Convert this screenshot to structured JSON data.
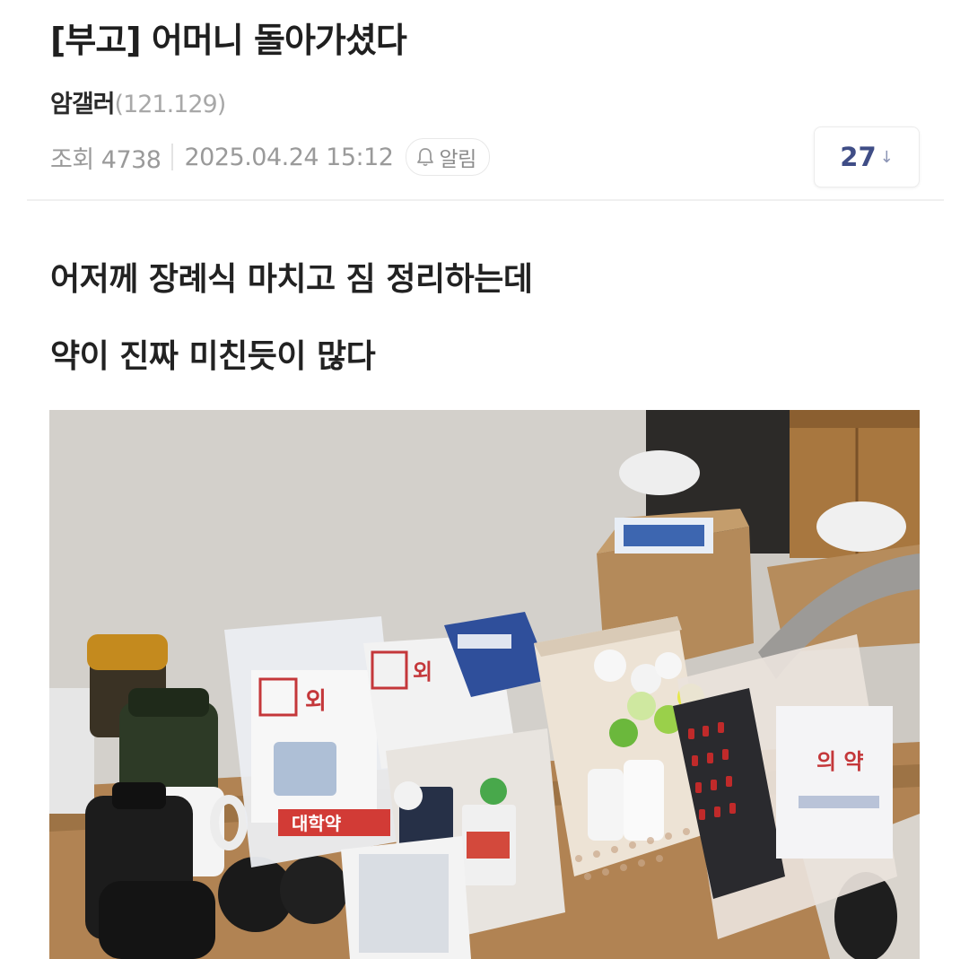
{
  "post": {
    "title": "[부고] 어머니 돌아가셨다",
    "author": "암갤러",
    "author_ip": "(121.129)",
    "views_label": "조회 4738",
    "datetime": "2025.04.24 15:12",
    "alarm_label": "알림",
    "comment_count": "27",
    "comment_arrow": "↓"
  },
  "content": {
    "lines": [
      "어저께 장례식 마치고 짐 정리하는데",
      "약이 진짜 미친듯이 많다"
    ],
    "photo_labels": {
      "bag_left": "외",
      "bag_left_bottom": "대학약",
      "bag_middle": "외",
      "bag_right": "의 약"
    }
  }
}
